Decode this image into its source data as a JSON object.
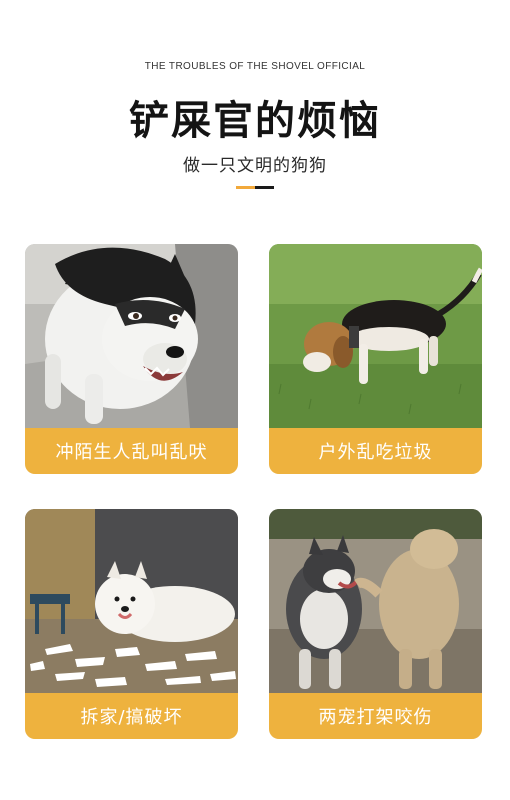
{
  "header": {
    "english_title": "THE TROUBLES OF THE SHOVEL OFFICIAL",
    "title": "铲屎官的烦恼",
    "subtitle": "做一只文明的狗狗"
  },
  "colors": {
    "accent": "#F2A93B",
    "caption_bar": "#EEB23E",
    "dark_accent": "#1a1a1a"
  },
  "cards": [
    {
      "caption": "冲陌生人乱叫乱吠",
      "image": "husky-barking-photo"
    },
    {
      "caption": "户外乱吃垃圾",
      "image": "beagle-sniffing-grass-photo"
    },
    {
      "caption": "拆家/搞破坏",
      "image": "samoyed-shredded-paper-photo"
    },
    {
      "caption": "两宠打架咬伤",
      "image": "dogs-fighting-photo"
    }
  ]
}
